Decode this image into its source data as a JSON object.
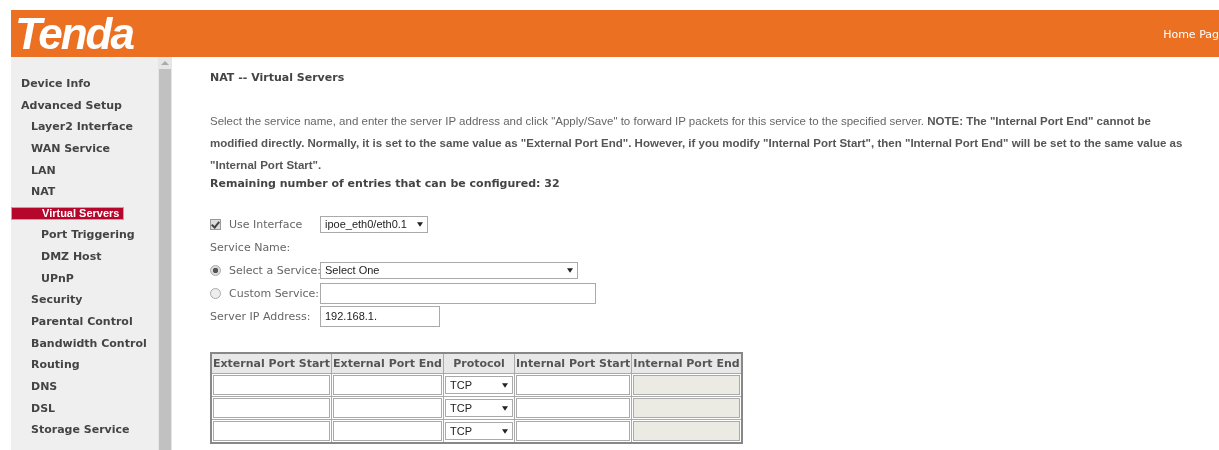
{
  "header": {
    "logo": "Tenda",
    "home_link": "Home Pag"
  },
  "sidebar": {
    "items": [
      {
        "label": "Device Info",
        "selected": false
      },
      {
        "label": "Advanced Setup",
        "selected": false,
        "children": [
          {
            "label": "Layer2 Interface",
            "selected": false
          },
          {
            "label": "WAN Service",
            "selected": false
          },
          {
            "label": "LAN",
            "selected": false
          },
          {
            "label": "NAT",
            "selected": false,
            "children": [
              {
                "label": "Virtual Servers",
                "selected": true
              },
              {
                "label": "Port Triggering",
                "selected": false
              },
              {
                "label": "DMZ Host",
                "selected": false
              },
              {
                "label": "UPnP",
                "selected": false
              }
            ]
          },
          {
            "label": "Security",
            "selected": false
          },
          {
            "label": "Parental Control",
            "selected": false
          },
          {
            "label": "Bandwidth Control",
            "selected": false
          },
          {
            "label": "Routing",
            "selected": false
          },
          {
            "label": "DNS",
            "selected": false
          },
          {
            "label": "DSL",
            "selected": false
          },
          {
            "label": "Storage Service",
            "selected": false
          }
        ]
      }
    ]
  },
  "page": {
    "title": "NAT -- Virtual Servers",
    "description": "Select the service name, and enter the server IP address and click \"Apply/Save\" to forward IP packets for this service to the specified server. **NOTE: The \"Internal Port End\" cannot be modified directly. Normally, it is set to the same value as \"External Port End\". However, if you modify \"Internal Port Start\", then \"Internal Port End\" will be set to the same value as \"Internal Port Start\".**",
    "remaining": "Remaining number of entries that can be configured: 32",
    "use_interface": {
      "label": "Use Interface",
      "checked": true,
      "value": "ipoe_eth0/eth0.1"
    },
    "service_name_label": "Service Name:",
    "service_options": [
      {
        "label": "Select a Service:",
        "selected": true,
        "kind": "select",
        "value": "Select One"
      },
      {
        "label": "Custom Service:",
        "selected": false,
        "kind": "text"
      }
    ],
    "server_ip": {
      "label": "Server IP Address:",
      "value": "192.168.1."
    }
  },
  "table": {
    "columns": [
      "External Port Start",
      "External Port End",
      "Protocol",
      "Internal Port Start",
      "Internal Port End"
    ],
    "rows": [
      {
        "protocol": "TCP",
        "internal_end_disabled": true
      },
      {
        "protocol": "TCP",
        "internal_end_disabled": true
      },
      {
        "protocol": "TCP",
        "internal_end_disabled": true
      }
    ]
  }
}
